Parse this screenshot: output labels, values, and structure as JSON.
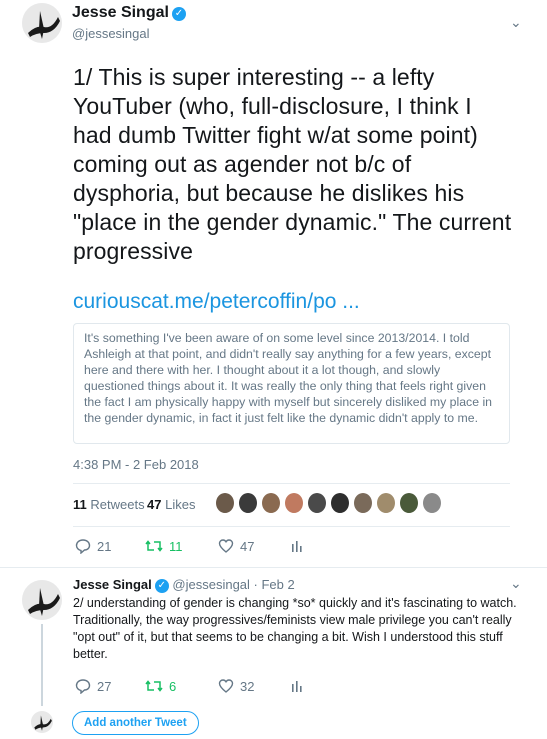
{
  "tweet1": {
    "name": "Jesse Singal",
    "handle": "@jessesingal",
    "text": "1/ This is super interesting -- a lefty YouTuber (who, full-disclosure, I think I had dumb Twitter fight w/at some point) coming out as agender not b/c of dysphoria, but because he dislikes his \"place in the gender dynamic.\" The current progressive",
    "link": "curiouscat.me/petercoffin/po ...",
    "quote": "It's something I've been aware of on some level since 2013/2014. I told Ashleigh at that point, and didn't really say anything for a few years, except here and there with her. I thought about it a lot though, and slowly questioned things about it. It was really the only thing that feels right given the fact I am physically happy with myself but sincerely disliked my place in the gender dynamic, in fact it just felt like the dynamic didn't apply to me.",
    "timestamp": "4:38 PM - 2 Feb 2018",
    "retweets_count": "11",
    "retweets_label": "Retweets",
    "likes_count": "47",
    "likes_label": "Likes",
    "reply_count": "21",
    "retweet_count": "11",
    "like_count": "47"
  },
  "tweet2": {
    "name": "Jesse Singal",
    "handle_date": "@jessesingal · Feb 2",
    "text": "2/ understanding of gender is changing *so* quickly and it's fascinating to watch. Traditionally, the way progressives/feminists view male privilege you can't really \"opt out\" of it, but that seems to be changing a bit. Wish I understood this stuff better.",
    "reply_count": "27",
    "retweet_count": "6",
    "like_count": "32"
  },
  "add_tweet_label": "Add another Tweet",
  "likers": [
    "#6b5a4a",
    "#3a3a3a",
    "#8a6a50",
    "#c07a60",
    "#4a4a4a",
    "#2e2e2e",
    "#7a6a5a",
    "#a08c6c",
    "#4a5a3a",
    "#8a8a8a"
  ],
  "colors": {
    "accent": "#1da1f2",
    "retweet": "#17bf63",
    "link": "#1b95e0"
  }
}
